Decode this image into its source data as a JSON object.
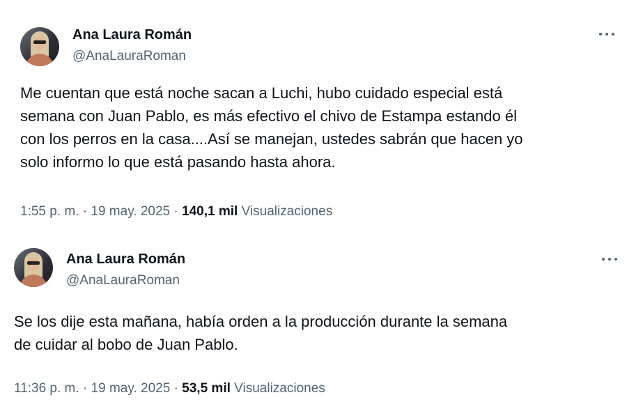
{
  "tweets": [
    {
      "author": {
        "name": "Ana Laura Román",
        "handle": "@AnaLauraRoman"
      },
      "text": "Me cuentan que está noche sacan a Luchi, hubo cuidado especial está\nsemana con Juan Pablo, es más efectivo el chivo de Estampa estando él\ncon los perros en la casa....Así se manejan, ustedes sabrán que hacen yo\nsolo informo lo que está pasando hasta ahora.",
      "time": "1:55 p. m.",
      "date": "19 may. 2025",
      "separator": "·",
      "views_count": "140,1 mil",
      "views_label": "Visualizaciones",
      "more_icon": "more-dots-icon"
    },
    {
      "author": {
        "name": "Ana Laura Román",
        "handle": "@AnaLauraRoman"
      },
      "text": "Se los dije esta mañana, había orden a la producción durante la semana\nde cuidar al bobo de Juan Pablo.",
      "time": "11:36 p. m.",
      "date": "19 may. 2025",
      "separator": "·",
      "views_count": "53,5 mil",
      "views_label": "Visualizaciones",
      "more_icon": "more-dots-icon"
    }
  ],
  "colors": {
    "text_primary": "#0f1419",
    "text_secondary": "#536471",
    "background": "#ffffff"
  }
}
